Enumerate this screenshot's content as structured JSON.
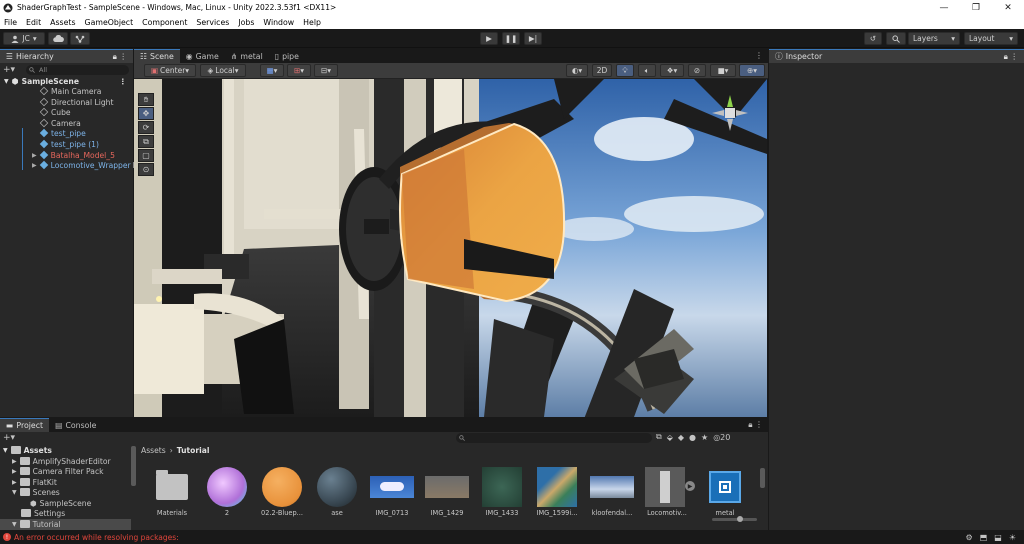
{
  "window": {
    "title": "ShaderGraphTest - SampleScene - Windows, Mac, Linux - Unity 2022.3.53f1 <DX11>",
    "min": "—",
    "max": "❐",
    "close": "✕"
  },
  "menu": [
    "File",
    "Edit",
    "Assets",
    "GameObject",
    "Component",
    "Services",
    "Jobs",
    "Window",
    "Help"
  ],
  "toolbar": {
    "account": "JC",
    "layers": "Layers",
    "layout": "Layout"
  },
  "hierarchy": {
    "tab": "Hierarchy",
    "search_placeholder": "All",
    "scene": "SampleScene",
    "items": [
      {
        "label": "Main Camera",
        "kind": "obj"
      },
      {
        "label": "Directional Light",
        "kind": "obj"
      },
      {
        "label": "Cube",
        "kind": "obj"
      },
      {
        "label": "Camera",
        "kind": "obj"
      },
      {
        "label": "test_pipe",
        "kind": "prefab"
      },
      {
        "label": "test_pipe (1)",
        "kind": "prefab"
      },
      {
        "label": "Batalha_Model_5",
        "kind": "missing"
      },
      {
        "label": "Locomotive_Wrapper",
        "kind": "prefab"
      }
    ]
  },
  "scene_tabs": [
    "Scene",
    "Game",
    "metal",
    "pipe"
  ],
  "scene_toolbar": {
    "pivot": "Center",
    "space": "Local",
    "mode_2d": "2D"
  },
  "inspector": {
    "tab": "Inspector"
  },
  "project": {
    "tabs": [
      "Project",
      "Console"
    ],
    "tree": [
      {
        "label": "Assets",
        "level": 0,
        "bold": true
      },
      {
        "label": "AmplifyShaderEditor",
        "level": 1
      },
      {
        "label": "Camera Filter Pack",
        "level": 1
      },
      {
        "label": "FlatKit",
        "level": 1
      },
      {
        "label": "Scenes",
        "level": 1
      },
      {
        "label": "SampleScene",
        "level": 2
      },
      {
        "label": "Settings",
        "level": 1
      },
      {
        "label": "Tutorial",
        "level": 1
      }
    ],
    "breadcrumb": [
      "Assets",
      "Tutorial"
    ],
    "hidden_count": "20",
    "assets": [
      {
        "label": "Materials",
        "kind": "folder"
      },
      {
        "label": "2",
        "kind": "sphere-purple"
      },
      {
        "label": "02.2-Bluep...",
        "kind": "sphere-orange"
      },
      {
        "label": "ase",
        "kind": "sphere-dark"
      },
      {
        "label": "IMG_0713",
        "kind": "img-cloud"
      },
      {
        "label": "IMG_1429",
        "kind": "img-gray"
      },
      {
        "label": "IMG_1433",
        "kind": "img-green"
      },
      {
        "label": "IMG_1599i...",
        "kind": "img-map"
      },
      {
        "label": "kloofendal...",
        "kind": "img-sky"
      },
      {
        "label": "Locomotiv...",
        "kind": "prefab-model"
      },
      {
        "label": "metal",
        "kind": "shadergraph"
      }
    ]
  },
  "status": {
    "error": "An error occurred while resolving packages:"
  }
}
